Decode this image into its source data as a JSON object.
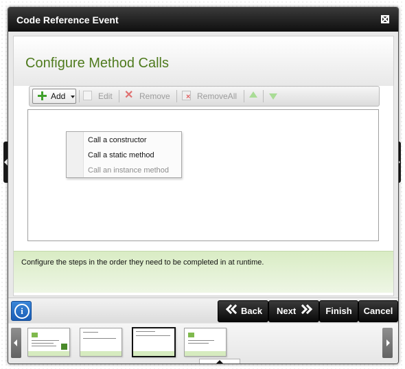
{
  "window": {
    "title": "Code Reference Event"
  },
  "page": {
    "title": "Configure Method Calls"
  },
  "toolbar": {
    "add_label": "Add",
    "edit_label": "Edit",
    "remove_label": "Remove",
    "removeall_label": "RemoveAll"
  },
  "dropdown": {
    "items": [
      {
        "label": "Call a constructor",
        "enabled": true
      },
      {
        "label": "Call a static method",
        "enabled": true
      },
      {
        "label": "Call an instance method",
        "enabled": false
      }
    ]
  },
  "info_bar": {
    "text": "Configure the steps in the order they need to be completed in at runtime."
  },
  "buttons": {
    "back": "Back",
    "next": "Next",
    "finish": "Finish",
    "cancel": "Cancel"
  },
  "icons": {
    "info": "i"
  },
  "colors": {
    "title_green": "#4e7a1d",
    "info_bar_bg": "#d9ecc4",
    "nav_button_bg": "#111111",
    "add_icon_green": "#3ea02a"
  }
}
